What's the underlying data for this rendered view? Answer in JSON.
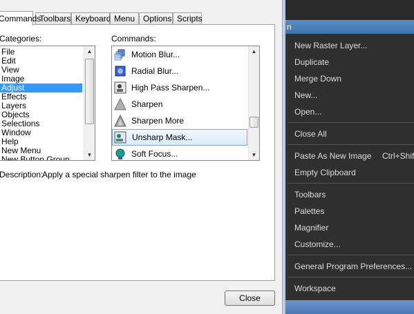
{
  "tabs": [
    {
      "label": "Commands",
      "active": true
    },
    {
      "label": "Toolbars"
    },
    {
      "label": "Keyboard"
    },
    {
      "label": "Menu"
    },
    {
      "label": "Options"
    },
    {
      "label": "Scripts"
    }
  ],
  "categories": {
    "label": "Categories:",
    "items": [
      "File",
      "Edit",
      "View",
      "Image",
      "Adjust",
      "Effects",
      "Layers",
      "Objects",
      "Selections",
      "Window",
      "Help",
      "New Menu",
      "New Button Group"
    ],
    "selected": "Adjust"
  },
  "commands": {
    "label": "Commands:",
    "items": [
      {
        "label": "Motion Blur...",
        "icon": "motion-blur-icon"
      },
      {
        "label": "Radial Blur...",
        "icon": "radial-blur-icon"
      },
      {
        "label": "High Pass Sharpen...",
        "icon": "high-pass-sharpen-icon"
      },
      {
        "label": "Sharpen",
        "icon": "sharpen-icon"
      },
      {
        "label": "Sharpen More",
        "icon": "sharpen-more-icon"
      },
      {
        "label": "Unsharp Mask...",
        "icon": "unsharp-mask-icon"
      },
      {
        "label": "Soft Focus...",
        "icon": "soft-focus-icon"
      }
    ],
    "selected": "Unsharp Mask..."
  },
  "description": {
    "label": "Description:",
    "text": "Apply a special sharpen filter to the image"
  },
  "close_label": "Close",
  "menu": {
    "title_fragment": "n",
    "items": [
      {
        "label": "New Raster Layer..."
      },
      {
        "label": "Duplicate"
      },
      {
        "label": "Merge Down"
      },
      {
        "label": "New..."
      },
      {
        "label": "Open..."
      },
      {
        "label": "Close All"
      },
      {
        "label": "Paste As New Image",
        "shortcut": "Ctrl+Shift"
      },
      {
        "label": "Empty Clipboard"
      },
      {
        "label": "Toolbars"
      },
      {
        "label": "Palettes"
      },
      {
        "label": "Magnifier"
      },
      {
        "label": "Customize..."
      },
      {
        "label": "General Program Preferences..."
      },
      {
        "label": "Workspace"
      }
    ]
  },
  "colors": {
    "selection": "#3399ff",
    "menu_bg": "#2f2f2f",
    "menu_text": "#dcdcdc",
    "title_bar": "#4a7fbf"
  }
}
